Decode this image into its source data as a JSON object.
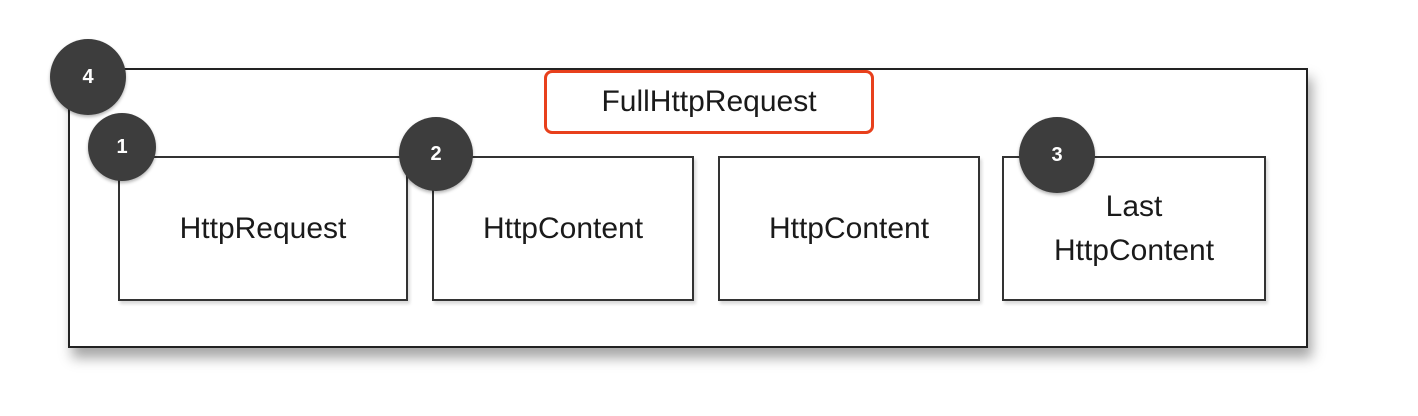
{
  "container": {
    "title": "FullHttpRequest",
    "badge": "4"
  },
  "parts": [
    {
      "badge": "1",
      "label_lines": [
        "HttpRequest"
      ]
    },
    {
      "badge": "2",
      "label_lines": [
        "HttpContent"
      ]
    },
    {
      "badge": "",
      "label_lines": [
        "HttpContent"
      ]
    },
    {
      "badge": "3",
      "label_lines": [
        "Last",
        "HttpContent"
      ]
    }
  ],
  "colors": {
    "badge_fill": "#3d3d3d",
    "highlight_border": "#e8401c",
    "box_border": "#222222"
  }
}
